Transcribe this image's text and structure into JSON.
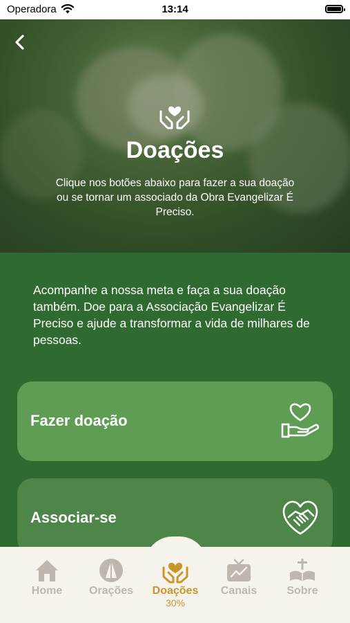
{
  "status_bar": {
    "carrier": "Operadora",
    "time": "13:14"
  },
  "header": {
    "title": "Doações",
    "subtitle": "Clique nos botões abaixo para fazer a sua doação ou se tornar um associado da Obra Evangelizar É Preciso."
  },
  "intro": "Acompanhe a nossa meta e faça a sua doação também. Doe para a Associação Evangelizar É Preciso e ajude a transformar a vida de milhares de pessoas.",
  "cards": [
    {
      "label": "Fazer doação",
      "icon": "heart-hand-icon"
    },
    {
      "label": "Associar-se",
      "icon": "handshake-heart-icon"
    }
  ],
  "tabs": [
    {
      "label": "Home",
      "icon": "home-icon"
    },
    {
      "label": "Orações",
      "icon": "praying-hands-icon"
    },
    {
      "label": "Doações",
      "icon": "heart-hands-icon",
      "sub": "30%"
    },
    {
      "label": "Canais",
      "icon": "tv-icon"
    },
    {
      "label": "Sobre",
      "icon": "bible-cross-icon"
    }
  ],
  "colors": {
    "primary_green": "#2f6a31",
    "card_green": "#5f9d55",
    "accent_gold": "#c9962a",
    "tab_inactive": "#bfb7ad"
  }
}
